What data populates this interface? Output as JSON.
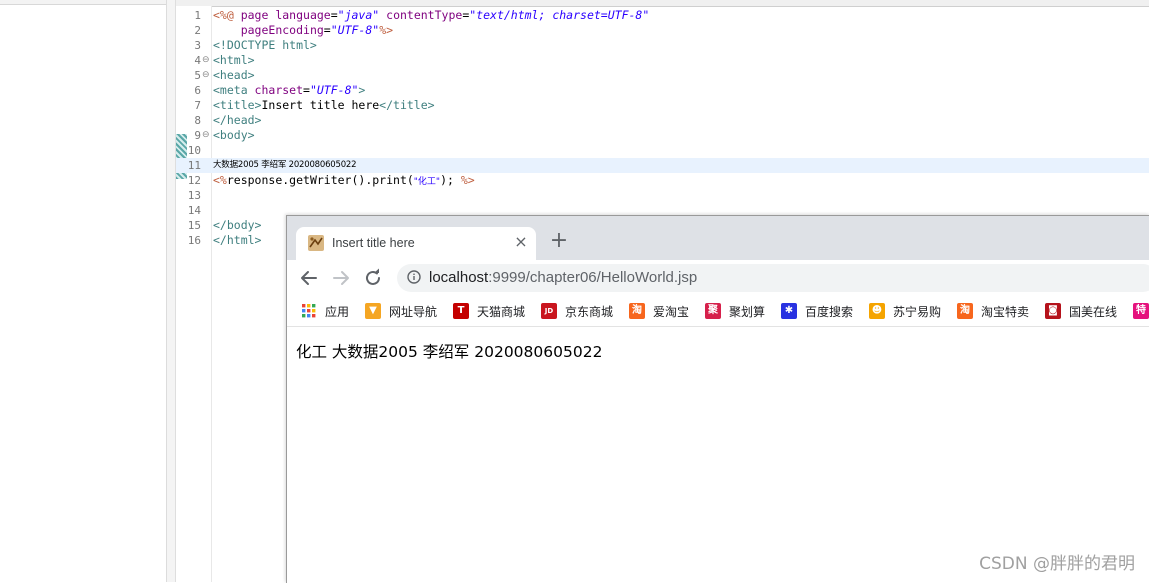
{
  "editor": {
    "lines": [
      {
        "num": "1",
        "parts": [
          [
            "jsp",
            "<%@ "
          ],
          [
            "attr",
            "page "
          ],
          [
            "attr",
            "language"
          ],
          [
            "plain",
            "="
          ],
          [
            "str",
            "\"java\""
          ],
          [
            "plain",
            " "
          ],
          [
            "attr",
            "contentType"
          ],
          [
            "plain",
            "="
          ],
          [
            "str",
            "\"text/html; charset=UTF-8\""
          ]
        ]
      },
      {
        "num": "2",
        "parts": [
          [
            "plain",
            "    "
          ],
          [
            "attr",
            "pageEncoding"
          ],
          [
            "plain",
            "="
          ],
          [
            "str",
            "\"UTF-8\""
          ],
          [
            "jsp",
            "%>"
          ]
        ]
      },
      {
        "num": "3",
        "parts": [
          [
            "tag",
            "<!DOCTYPE html>"
          ]
        ]
      },
      {
        "num": "4",
        "fold": "⊖",
        "parts": [
          [
            "tag",
            "<html>"
          ]
        ]
      },
      {
        "num": "5",
        "fold": "⊖",
        "parts": [
          [
            "tag",
            "<head>"
          ]
        ]
      },
      {
        "num": "6",
        "parts": [
          [
            "tag",
            "<meta "
          ],
          [
            "attr",
            "charset"
          ],
          [
            "plain",
            "="
          ],
          [
            "str",
            "\"UTF-8\""
          ],
          [
            "tag",
            ">"
          ]
        ]
      },
      {
        "num": "7",
        "parts": [
          [
            "tag",
            "<title>"
          ],
          [
            "plain",
            "Insert title here"
          ],
          [
            "tag",
            "</title>"
          ]
        ]
      },
      {
        "num": "8",
        "parts": [
          [
            "tag",
            "</head>"
          ]
        ]
      },
      {
        "num": "9",
        "fold": "⊖",
        "parts": [
          [
            "tag",
            "<body>"
          ]
        ]
      },
      {
        "num": "10",
        "parts": []
      },
      {
        "num": "11",
        "current": true,
        "small": true,
        "parts": [
          [
            "plain",
            "大数据2005 李绍军 2020080605022"
          ]
        ]
      },
      {
        "num": "12",
        "parts": [
          [
            "jsp",
            "<%"
          ],
          [
            "plain",
            "response.getWriter().print("
          ],
          [
            "cjk",
            "\"化工\""
          ],
          [
            "plain",
            "); "
          ],
          [
            "jsp",
            "%>"
          ]
        ]
      },
      {
        "num": "13",
        "parts": []
      },
      {
        "num": "14",
        "parts": []
      },
      {
        "num": "15",
        "parts": [
          [
            "tag",
            "</body>"
          ]
        ]
      },
      {
        "num": "16",
        "parts": [
          [
            "tag",
            "</html>"
          ]
        ]
      }
    ]
  },
  "browser": {
    "tab_title": "Insert title here",
    "tab_close": "×",
    "new_tab": "+",
    "url_host": "localhost",
    "url_path": ":9999/chapter06/HelloWorld.jsp",
    "bookmarks": [
      {
        "label": "应用",
        "icon": "apps-grid-icon",
        "color": "#ea4335"
      },
      {
        "label": "网址导航",
        "icon": "nav-arrow-icon",
        "color": "#f5a623",
        "glyph": "▼"
      },
      {
        "label": "天猫商城",
        "icon": "tmall-icon",
        "color": "#c40000",
        "glyph": "T"
      },
      {
        "label": "京东商城",
        "icon": "jd-icon",
        "color": "#c9151e",
        "glyph": "JD"
      },
      {
        "label": "爱淘宝",
        "icon": "aitaobao-icon",
        "color": "#f7661d",
        "glyph": "淘"
      },
      {
        "label": "聚划算",
        "icon": "juhuasuan-icon",
        "color": "#d6204b",
        "glyph": "聚"
      },
      {
        "label": "百度搜索",
        "icon": "baidu-paw-icon",
        "color": "#2932e1",
        "glyph": "✱"
      },
      {
        "label": "苏宁易购",
        "icon": "suning-icon",
        "color": "#f5a400",
        "glyph": "☻"
      },
      {
        "label": "淘宝特卖",
        "icon": "taobao-sale-icon",
        "color": "#f7661d",
        "glyph": "淘"
      },
      {
        "label": "国美在线",
        "icon": "gome-icon",
        "color": "#b5121b",
        "glyph": "◙"
      },
      {
        "label": "特",
        "icon": "tebao-icon",
        "color": "#e5127d",
        "glyph": "特"
      }
    ],
    "page_text": "化工 大数据2005 李绍军 2020080605022"
  },
  "watermark": "CSDN @胖胖的君明"
}
